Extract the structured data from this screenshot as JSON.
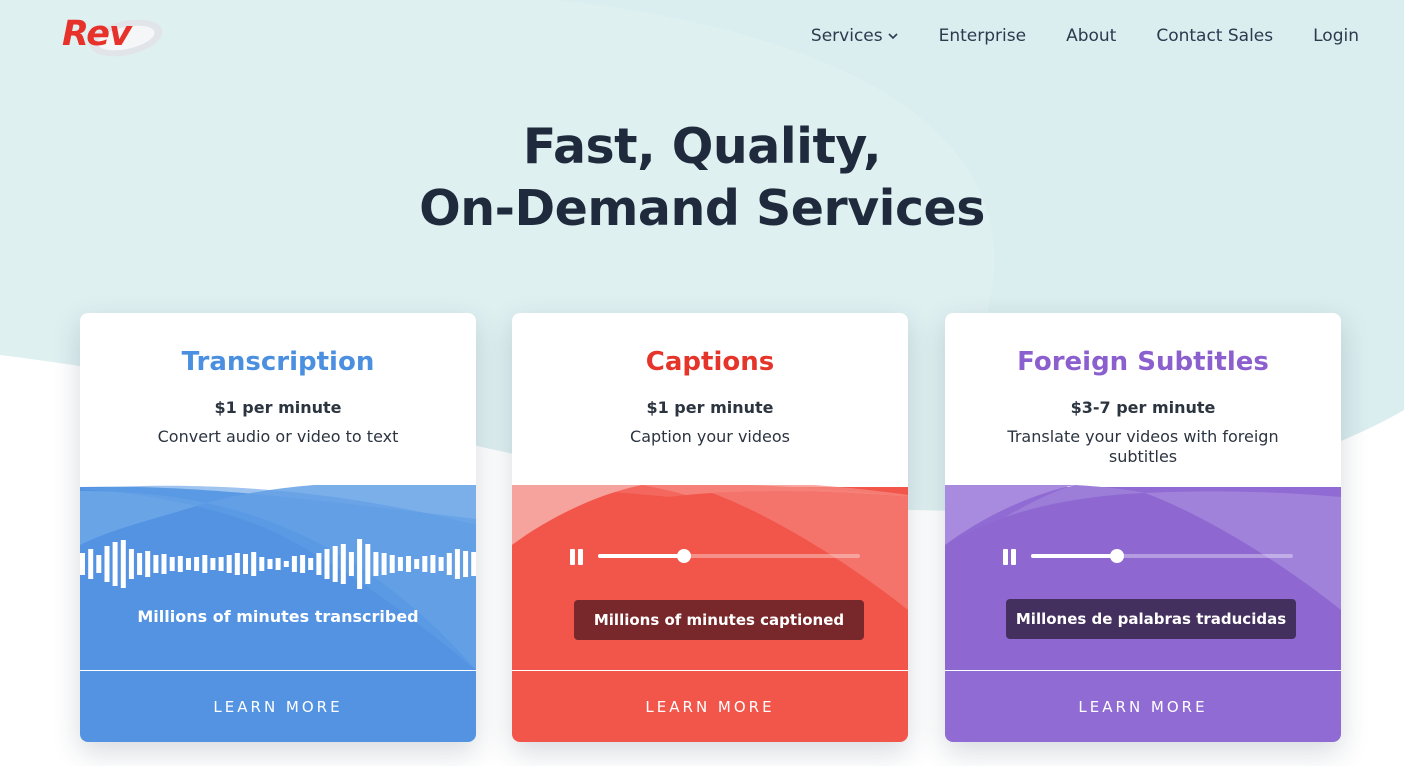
{
  "brand": {
    "logo_text": "Rev",
    "logo_color": "#e7312b"
  },
  "nav": {
    "items": [
      {
        "label": "Services",
        "has_dropdown": true,
        "icon": "chevron-down-icon"
      },
      {
        "label": "Enterprise"
      },
      {
        "label": "About"
      },
      {
        "label": "Contact Sales"
      },
      {
        "label": "Login"
      }
    ]
  },
  "hero": {
    "title_line1": "Fast, Quality,",
    "title_line2": "On-Demand Services"
  },
  "cards": [
    {
      "title": "Transcription",
      "price": "$1 per minute",
      "description": "Convert audio or video to text",
      "visual_caption": "Millions of minutes transcribed",
      "cta": "LEARN MORE",
      "accent": "#5393e2",
      "title_color": "#4a8fe0"
    },
    {
      "title": "Captions",
      "price": "$1 per minute",
      "description": "Caption your videos",
      "visual_caption": "Millions of minutes captioned",
      "cta": "LEARN MORE",
      "accent": "#f2554a",
      "title_color": "#e5352b",
      "progress": 0.33
    },
    {
      "title": "Foreign Subtitles",
      "price": "$3-7 per minute",
      "description": "Translate your videos with foreign subtitles",
      "visual_caption": "Millones de palabras traducidas",
      "cta": "LEARN MORE",
      "accent": "#8f6bd3",
      "title_color": "#8c5fce",
      "progress": 0.33
    }
  ]
}
